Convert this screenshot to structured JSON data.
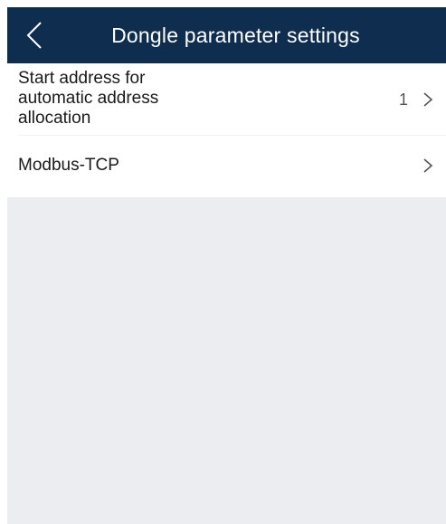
{
  "header": {
    "title": "Dongle parameter settings",
    "back_icon": "chevron-left-icon",
    "background_color": "#0f2d4f"
  },
  "settings": {
    "items": [
      {
        "label": "Start address for automatic address allocation",
        "value": "1",
        "icon": "chevron-right-icon"
      },
      {
        "label": "Modbus-TCP",
        "value": "",
        "icon": "chevron-right-icon"
      }
    ]
  },
  "colors": {
    "page_background": "#ebedf1",
    "row_background": "#ffffff",
    "text": "#1a1a1a"
  }
}
